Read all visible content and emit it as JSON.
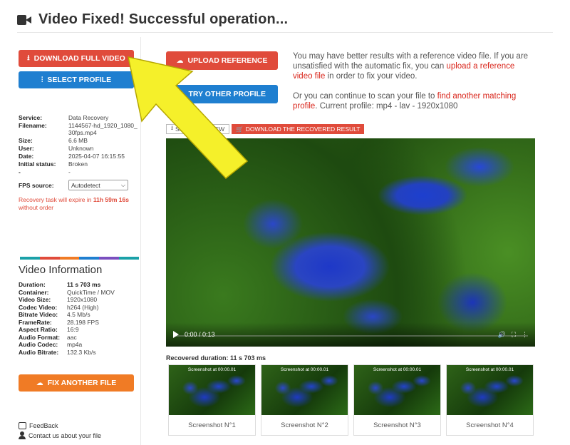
{
  "header": {
    "title": "Video Fixed! Successful operation..."
  },
  "left": {
    "download_btn": "DOWNLOAD FULL VIDEO",
    "select_profile_btn": "SELECT PROFILE",
    "info": [
      {
        "k": "Service:",
        "v": "Data Recovery"
      },
      {
        "k": "Filename:",
        "v": "1144567-hd_1920_1080_30fps.mp4"
      },
      {
        "k": "Size:",
        "v": "6.6 MB"
      },
      {
        "k": "User:",
        "v": "Unknown"
      },
      {
        "k": "Date:",
        "v": "2025-04-07 16:15:55"
      },
      {
        "k": "Initial status:",
        "v": "Broken"
      },
      {
        "k": "-",
        "v": "-"
      }
    ],
    "fps_label": "FPS source:",
    "fps_value": "Autodetect",
    "expire_pre": "Recovery task will expire in ",
    "expire_time": "11h 59m 16s",
    "expire_post": "without order",
    "color_bar": [
      "#1aa1a8",
      "#e04b3b",
      "#f07b25",
      "#1f7fd0",
      "#7a4fbf",
      "#1aa1a8"
    ],
    "video_info_title": "Video Information",
    "video_info": [
      {
        "k": "Duration:",
        "v": "11 s 703 ms",
        "bold": true
      },
      {
        "k": "Container:",
        "v": "QuickTime / MOV"
      },
      {
        "k": "Video Size:",
        "v": "1920x1080"
      },
      {
        "k": "Codec Video:",
        "v": "h264 (High)"
      },
      {
        "k": "Bitrate Video:",
        "v": "4.5 Mb/s"
      },
      {
        "k": "FrameRate:",
        "v": "28.198 FPS"
      },
      {
        "k": "Aspect Ratio:",
        "v": "16:9"
      },
      {
        "k": "Audio Format:",
        "v": "aac"
      },
      {
        "k": "Audio Codec:",
        "v": "mp4a"
      },
      {
        "k": "Audio Bitrate:",
        "v": "132.3 Kb/s"
      }
    ],
    "fix_another_btn": "FIX ANOTHER FILE",
    "feedback": "FeedBack",
    "contact": "Contact us about your file"
  },
  "right": {
    "upload_ref_btn": "UPLOAD REFERENCE",
    "try_other_btn": "TRY OTHER PROFILE",
    "msg1_pre": "You may have better results with a reference video file. If you are unsatisfied with the automatic fix, you can ",
    "msg1_link": "upload a reference video file",
    "msg1_post": " in order to fix your video.",
    "msg2_pre": "Or you can continue to scan your file to ",
    "msg2_link": "find another matching profile",
    "msg2_post": ". Current profile: mp4 - lav - 1920x1080",
    "tab_small": "SMALL PREVIEW",
    "tab_download": "DOWNLOAD THE RECOVERED RESULT",
    "player_time": "0:00 / 0:13",
    "recovered_duration": "Recovered duration: 11 s 703 ms",
    "shots": [
      {
        "ts": "Screenshot at 00:00.01",
        "cap": "Screenshot N°1"
      },
      {
        "ts": "Screenshot at 00:00.01",
        "cap": "Screenshot N°2"
      },
      {
        "ts": "Screenshot at 00:00.01",
        "cap": "Screenshot N°3"
      },
      {
        "ts": "Screenshot at 00:00.01",
        "cap": "Screenshot N°4"
      }
    ]
  }
}
